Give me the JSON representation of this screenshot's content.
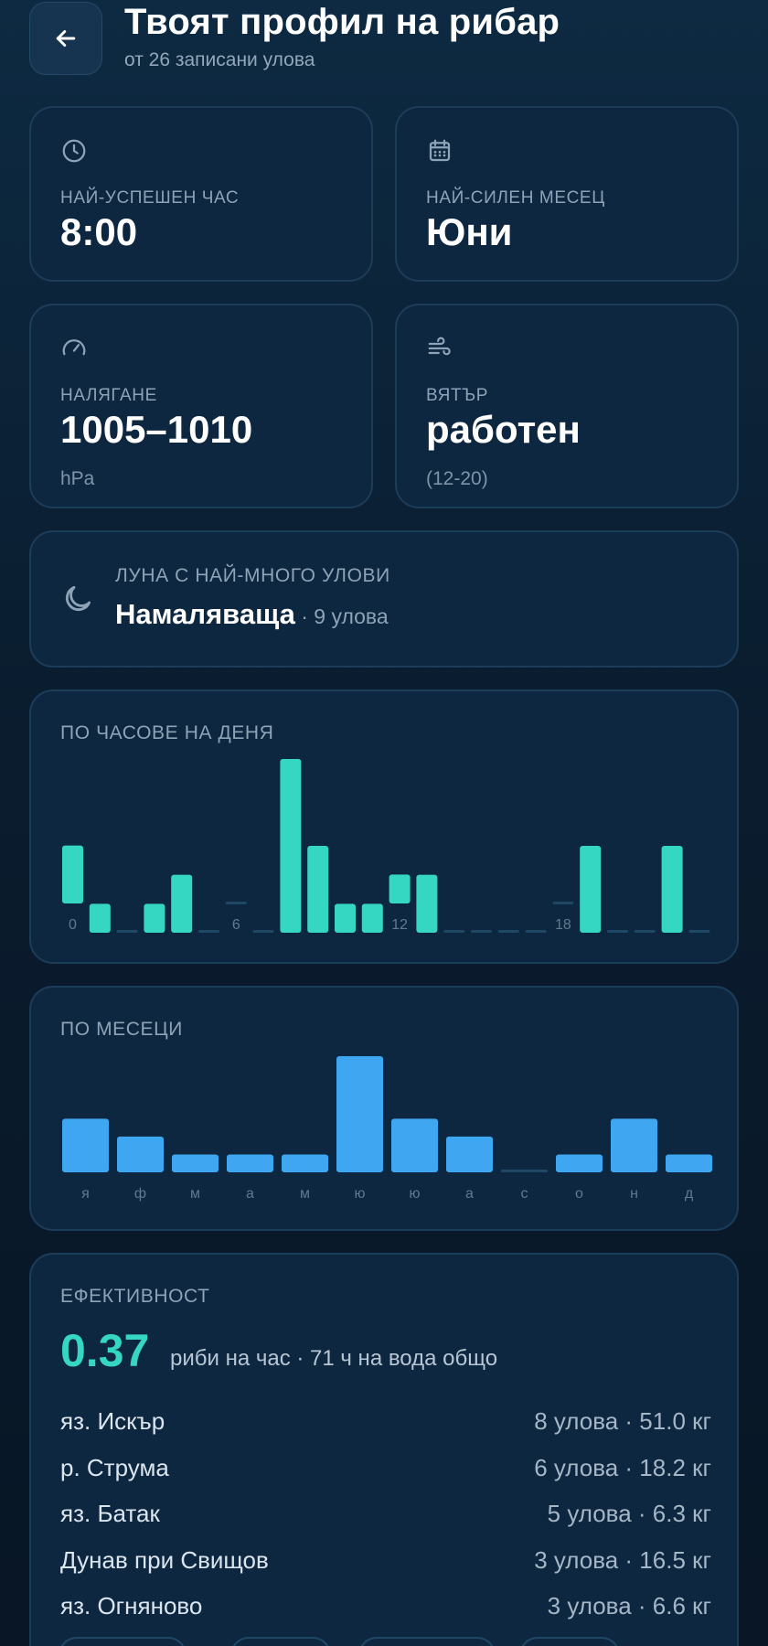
{
  "header": {
    "title": "Твоят профил на рибар",
    "subtitle": "от 26 записани улова"
  },
  "stats": [
    {
      "icon": "clock-icon",
      "label": "НАЙ-УСПЕШЕН ЧАС",
      "value": "8:00",
      "unit": ""
    },
    {
      "icon": "calendar-icon",
      "label": "НАЙ-СИЛЕН МЕСЕЦ",
      "value": "Юни",
      "unit": ""
    },
    {
      "icon": "gauge-icon",
      "label": "НАЛЯГАНЕ",
      "value": "1005–1010",
      "unit": "hPa"
    },
    {
      "icon": "wind-icon",
      "label": "ВЯТЪР",
      "value": "работен",
      "unit": "(12-20)"
    }
  ],
  "moon": {
    "label": "ЛУНА С НАЙ-МНОГО УЛОВИ",
    "phase": "Намаляваща",
    "count": " · 9 улова"
  },
  "chart_data": [
    {
      "type": "bar",
      "title": "ПО ЧАСОВЕ НА ДЕНЯ",
      "categories": [
        "0",
        "1",
        "2",
        "3",
        "4",
        "5",
        "6",
        "7",
        "8",
        "9",
        "10",
        "11",
        "12",
        "13",
        "14",
        "15",
        "16",
        "17",
        "18",
        "19",
        "20",
        "21",
        "22",
        "23"
      ],
      "tick_labels": [
        "0",
        "6",
        "12",
        "18"
      ],
      "values": [
        2,
        1,
        0,
        1,
        2,
        0,
        0,
        0,
        6,
        3,
        1,
        1,
        1,
        2,
        0,
        0,
        0,
        0,
        0,
        3,
        0,
        0,
        3,
        0
      ],
      "ylim": [
        0,
        6
      ],
      "color": "#35d6c2"
    },
    {
      "type": "bar",
      "title": "ПО МЕСЕЦИ",
      "categories": [
        "я",
        "ф",
        "м",
        "а",
        "м",
        "ю",
        "ю",
        "а",
        "с",
        "о",
        "н",
        "д"
      ],
      "values": [
        3,
        2,
        1,
        1,
        1,
        6.5,
        3,
        2,
        0,
        1,
        3,
        1
      ],
      "ylim": [
        0,
        6.5
      ],
      "color": "#3fa7f2"
    }
  ],
  "efficiency": {
    "label": "ЕФЕКТИВНОСТ",
    "value": "0.37",
    "text": "риби на час · 71 ч на вода общо",
    "lakes": [
      {
        "name": "яз. Искър",
        "stats": "8 улова · 51.0 кг"
      },
      {
        "name": "р. Струма",
        "stats": "6 улова · 18.2 кг"
      },
      {
        "name": "яз. Батак",
        "stats": "5 улова · 6.3 кг"
      },
      {
        "name": "Дунав при Свищов",
        "stats": "3 улова · 16.5 кг"
      },
      {
        "name": "яз. Огняново",
        "stats": "3 улова · 6.6 кг"
      }
    ]
  },
  "colors": {
    "accent_teal": "#35d6c2",
    "accent_blue": "#3fa7f2",
    "card_bg": "#0e2740",
    "empty_bar": "#1f4766"
  }
}
